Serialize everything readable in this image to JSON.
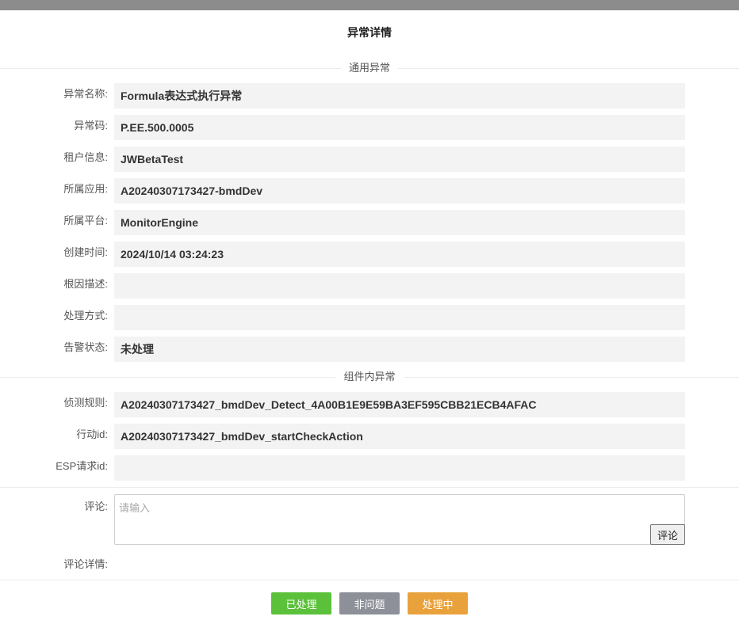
{
  "dialog": {
    "title": "异常详情"
  },
  "sections": {
    "general": "通用异常",
    "component": "组件内异常"
  },
  "general_fields": [
    {
      "label": "异常名称:",
      "value": "Formula表达式执行异常"
    },
    {
      "label": "异常码:",
      "value": "P.EE.500.0005"
    },
    {
      "label": "租户信息:",
      "value": "JWBetaTest"
    },
    {
      "label": "所属应用:",
      "value": "A20240307173427-bmdDev"
    },
    {
      "label": "所属平台:",
      "value": "MonitorEngine"
    },
    {
      "label": "创建时间:",
      "value": "2024/10/14 03:24:23"
    },
    {
      "label": "根因描述:",
      "value": ""
    },
    {
      "label": "处理方式:",
      "value": ""
    },
    {
      "label": "告警状态:",
      "value": "未处理"
    }
  ],
  "component_fields": [
    {
      "label": "侦测规则:",
      "value": "A20240307173427_bmdDev_Detect_4A00B1E9E59BA3EF595CBB21ECB4AFAC"
    },
    {
      "label": "行动id:",
      "value": "A20240307173427_bmdDev_startCheckAction"
    },
    {
      "label": "ESP请求id:",
      "value": ""
    }
  ],
  "comment": {
    "label": "评论:",
    "placeholder": "请输入",
    "value": "",
    "button": "评论",
    "detail_label": "评论详情:"
  },
  "actions": [
    {
      "label": "已处理",
      "color": "#5cc13a"
    },
    {
      "label": "非问题",
      "color": "#8e9099"
    },
    {
      "label": "处理中",
      "color": "#e9a23b"
    }
  ]
}
